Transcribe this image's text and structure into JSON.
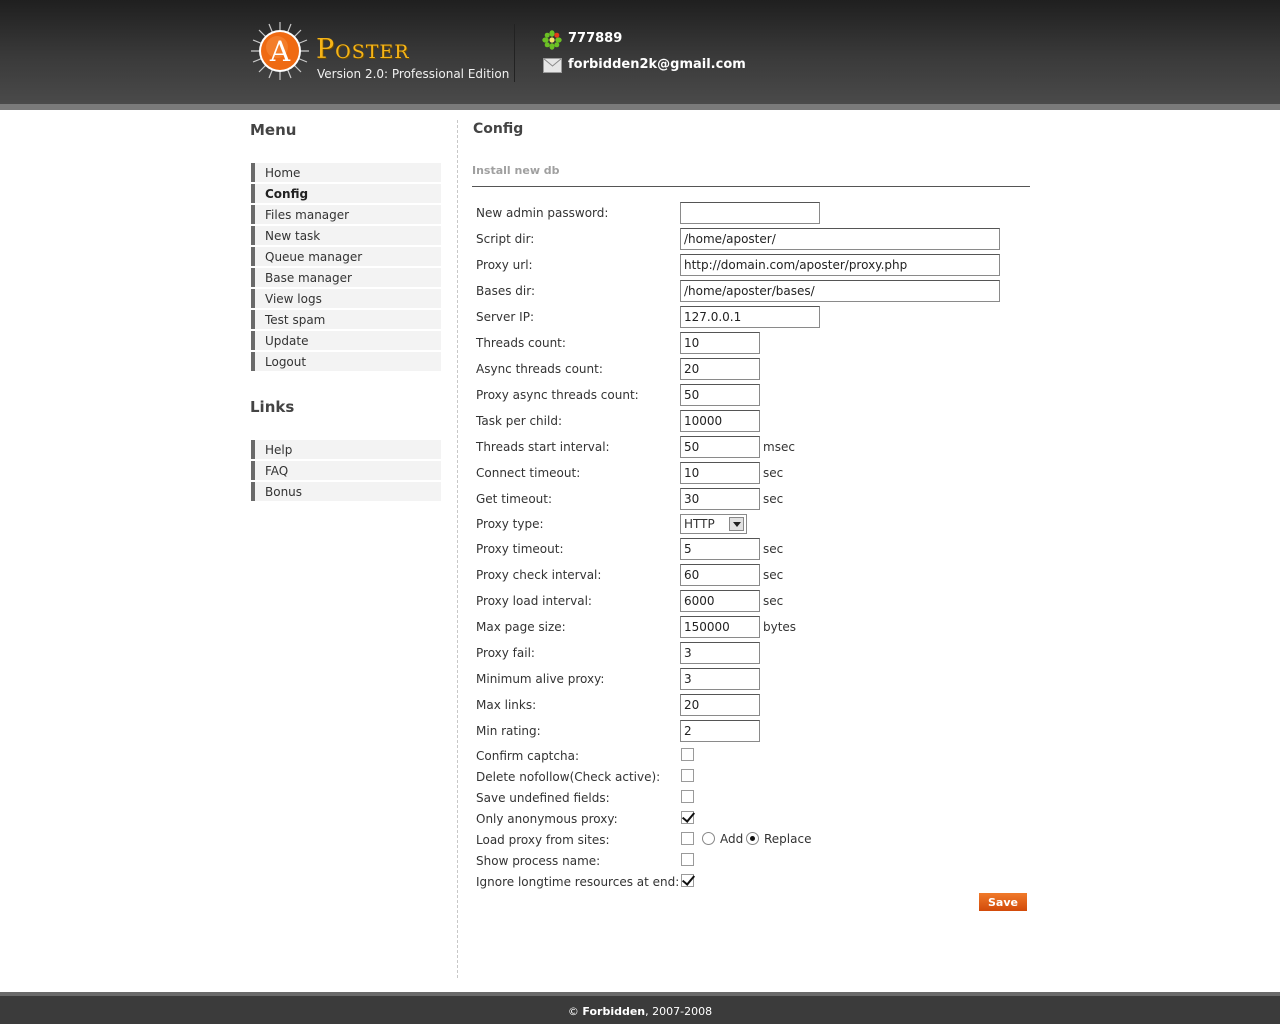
{
  "header": {
    "logo_letter": "A",
    "logo_title": "Poster",
    "version": "Version 2.0: Professional Edition",
    "icq": "777889",
    "email": "forbidden2k@gmail.com"
  },
  "sidebar": {
    "menu_heading": "Menu",
    "menu_items": [
      {
        "label": "Home"
      },
      {
        "label": "Config",
        "active": true
      },
      {
        "label": "Files manager"
      },
      {
        "label": "New task"
      },
      {
        "label": "Queue manager"
      },
      {
        "label": "Base manager"
      },
      {
        "label": "View logs"
      },
      {
        "label": "Test spam"
      },
      {
        "label": "Update"
      },
      {
        "label": "Logout"
      }
    ],
    "links_heading": "Links",
    "links_items": [
      {
        "label": "Help"
      },
      {
        "label": "FAQ"
      },
      {
        "label": "Bonus"
      }
    ]
  },
  "main": {
    "title": "Config",
    "install_link": "Install new db",
    "fields": {
      "admin_password": {
        "label": "New admin password:",
        "value": ""
      },
      "script_dir": {
        "label": "Script dir:",
        "value": "/home/aposter/"
      },
      "proxy_url": {
        "label": "Proxy url:",
        "value": "http://domain.com/aposter/proxy.php"
      },
      "bases_dir": {
        "label": "Bases dir:",
        "value": "/home/aposter/bases/"
      },
      "server_ip": {
        "label": "Server IP:",
        "value": "127.0.0.1"
      },
      "threads_count": {
        "label": "Threads count:",
        "value": "10"
      },
      "async_threads": {
        "label": "Async threads count:",
        "value": "20"
      },
      "proxy_async_threads": {
        "label": "Proxy async threads count:",
        "value": "50"
      },
      "task_per_child": {
        "label": "Task per child:",
        "value": "10000"
      },
      "threads_start_interval": {
        "label": "Threads start interval:",
        "value": "50",
        "unit": "msec"
      },
      "connect_timeout": {
        "label": "Connect timeout:",
        "value": "10",
        "unit": "sec"
      },
      "get_timeout": {
        "label": "Get timeout:",
        "value": "30",
        "unit": "sec"
      },
      "proxy_type": {
        "label": "Proxy type:",
        "value": "HTTP"
      },
      "proxy_timeout": {
        "label": "Proxy timeout:",
        "value": "5",
        "unit": "sec"
      },
      "proxy_check_interval": {
        "label": "Proxy check interval:",
        "value": "60",
        "unit": "sec"
      },
      "proxy_load_interval": {
        "label": "Proxy load interval:",
        "value": "6000",
        "unit": "sec"
      },
      "max_page_size": {
        "label": "Max page size:",
        "value": "150000",
        "unit": "bytes"
      },
      "proxy_fail": {
        "label": "Proxy fail:",
        "value": "3"
      },
      "min_alive_proxy": {
        "label": "Minimum alive proxy:",
        "value": "3"
      },
      "max_links": {
        "label": "Max links:",
        "value": "20"
      },
      "min_rating": {
        "label": "Min rating:",
        "value": "2"
      }
    },
    "checkboxes": {
      "confirm_captcha": {
        "label": "Confirm captcha:",
        "checked": false
      },
      "delete_nofollow": {
        "label": "Delete nofollow(Check active):",
        "checked": false
      },
      "save_undefined": {
        "label": "Save undefined fields:",
        "checked": false
      },
      "only_anonymous": {
        "label": "Only anonymous proxy:",
        "checked": true
      },
      "load_proxy": {
        "label": "Load proxy from sites:",
        "checked": false
      },
      "show_process": {
        "label": "Show process name:",
        "checked": false
      },
      "ignore_longtime": {
        "label": "Ignore longtime resources at end:",
        "checked": true
      }
    },
    "load_proxy_radio": {
      "add_label": "Add",
      "replace_label": "Replace",
      "selected": "Replace"
    },
    "save_label": "Save"
  },
  "footer": {
    "copyright": "©",
    "owner": "Forbidden",
    "years": ", 2007-2008"
  },
  "colors": {
    "accent": "#e0561a",
    "logo_orange": "#f6b417",
    "header_bg": "#2e2e2e"
  }
}
